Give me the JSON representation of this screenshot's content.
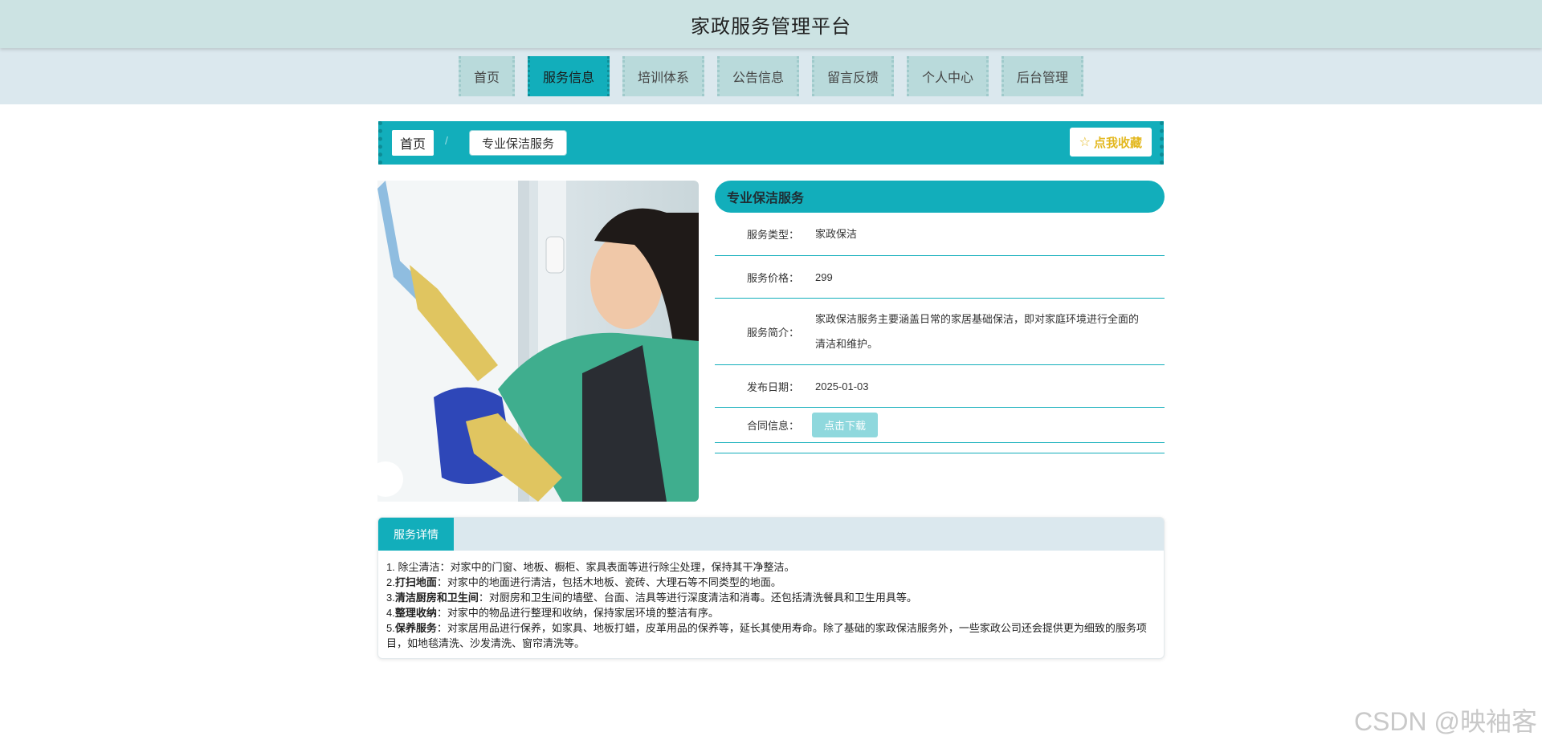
{
  "header": {
    "title": "家政服务管理平台"
  },
  "nav": {
    "items": [
      {
        "label": "首页"
      },
      {
        "label": "服务信息",
        "active": true
      },
      {
        "label": "培训体系"
      },
      {
        "label": "公告信息"
      },
      {
        "label": "留言反馈"
      },
      {
        "label": "个人中心"
      },
      {
        "label": "后台管理"
      }
    ]
  },
  "breadcrumb": {
    "home": "首页",
    "separator": "/",
    "current": "专业保洁服务"
  },
  "favorite": {
    "label": "点我收藏",
    "icon": "star-outline-icon"
  },
  "service": {
    "title": "专业保洁服务",
    "rows": [
      {
        "label": "服务类型：",
        "value": "家政保洁"
      },
      {
        "label": "服务价格：",
        "value": "299"
      },
      {
        "label": "服务简介：",
        "value": "家政保洁服务主要涵盖日常的家居基础保洁，即对家庭环境进行全面的清洁和维护。"
      },
      {
        "label": "发布日期：",
        "value": "2025-01-03"
      }
    ],
    "contract": {
      "label": "合同信息：",
      "button": "点击下载"
    }
  },
  "detail": {
    "tab": "服务详情",
    "lines": [
      {
        "prefix": "1. ",
        "head": "除尘清洁",
        "body": "：对家中的门窗、地板、橱柜、家具表面等进行除尘处理，保持其干净整洁。",
        "bold": false
      },
      {
        "prefix": "2.",
        "head": "打扫地面",
        "body": "：对家中的地面进行清洁，包括木地板、瓷砖、大理石等不同类型的地面。",
        "bold": true
      },
      {
        "prefix": "3.",
        "head": "清洁厨房和卫生间",
        "body": "：对厨房和卫生间的墙壁、台面、洁具等进行深度清洁和消毒。还包括清洗餐具和卫生用具等。",
        "bold": true
      },
      {
        "prefix": "4.",
        "head": "整理收纳",
        "body": "：对家中的物品进行整理和收纳，保持家居环境的整洁有序。",
        "bold": true
      },
      {
        "prefix": "5.",
        "head": "保养服务",
        "body": "：对家居用品进行保养，如家具、地板打蜡，皮革用品的保养等，延长其使用寿命。除了基础的家政保洁服务外，一些家政公司还会提供更为细致的服务项目，如地毯清洗、沙发清洗、窗帘清洗等。",
        "bold": true
      }
    ]
  },
  "watermark": "CSDN @映袖客",
  "colors": {
    "accent": "#12aebb",
    "nav_bg": "#b9dadb",
    "header_bg": "#cce3e3",
    "favorite": "#e3b81f"
  }
}
